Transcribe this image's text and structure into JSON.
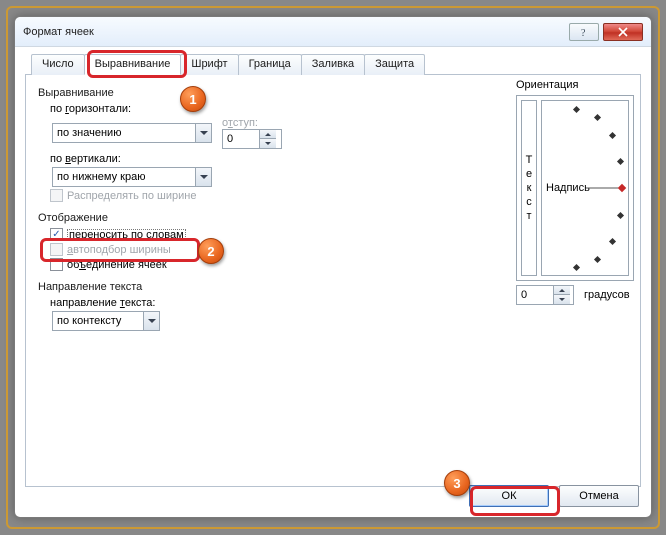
{
  "window": {
    "title": "Формат ячеек"
  },
  "tabs": {
    "items": [
      "Число",
      "Выравнивание",
      "Шрифт",
      "Граница",
      "Заливка",
      "Защита"
    ],
    "selected_index": 1
  },
  "alignment": {
    "group_label": "Выравнивание",
    "horizontal_label": "по горизонтали:",
    "horizontal_value": "по значению",
    "indent_label": "отступ:",
    "indent_value": "0",
    "vertical_label": "по вертикали:",
    "vertical_value": "по нижнему краю",
    "distribute_label": "Распределять по ширине"
  },
  "display": {
    "group_label": "Отображение",
    "wrap_label": "переносить по словам",
    "shrink_label": "автоподбор ширины",
    "merge_label": "объединение ячеек"
  },
  "text_direction": {
    "group_label": "Направление текста",
    "field_label": "направление текста:",
    "value": "по контексту"
  },
  "orientation": {
    "group_label": "Ориентация",
    "vertical_chars": [
      "Т",
      "е",
      "к",
      "с",
      "т"
    ],
    "radial_label": "Надпись",
    "degrees_label": "градусов",
    "degrees_value": "0"
  },
  "buttons": {
    "ok": "ОК",
    "cancel": "Отмена"
  },
  "callouts": {
    "c1": "1",
    "c2": "2",
    "c3": "3"
  }
}
